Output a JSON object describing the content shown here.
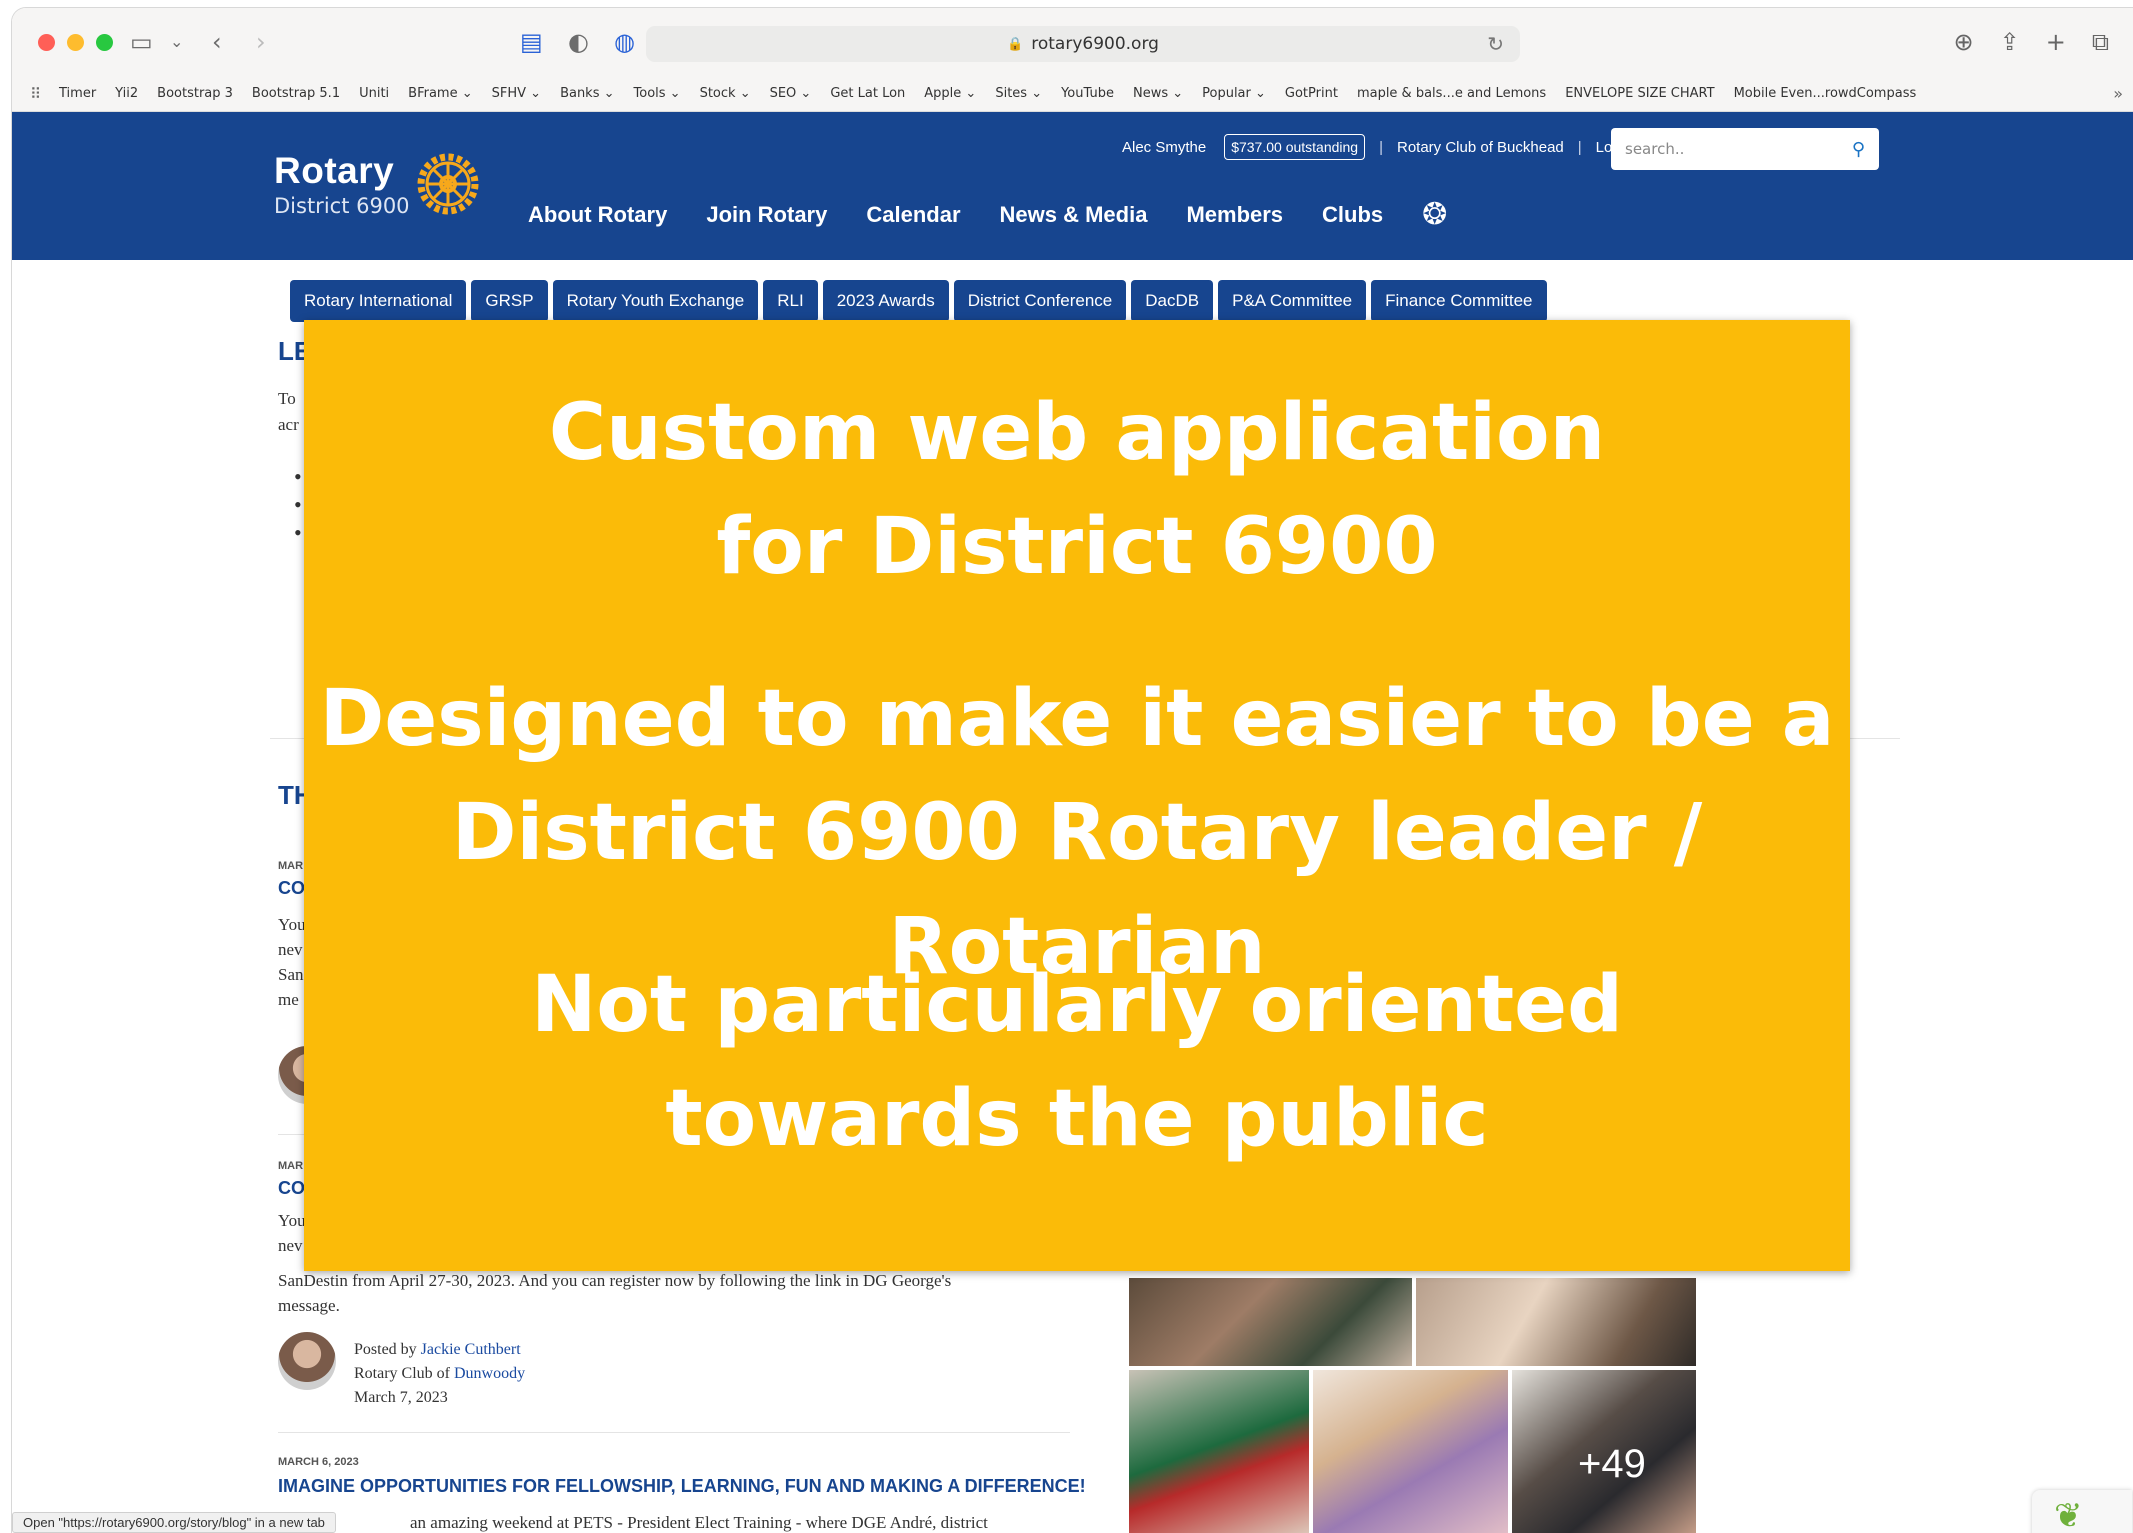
{
  "browser": {
    "url": "rotary6900.org",
    "bookmarks": [
      "Timer",
      "Yii2",
      "Bootstrap 3",
      "Bootstrap 5.1",
      "Uniti",
      "BFrame ⌄",
      "SFHV ⌄",
      "Banks ⌄",
      "Tools ⌄",
      "Stock ⌄",
      "SEO ⌄",
      "Get Lat Lon",
      "Apple ⌄",
      "Sites ⌄",
      "YouTube",
      "News ⌄",
      "Popular ⌄",
      "GotPrint",
      "maple & bals...e and Lemons",
      "ENVELOPE SIZE CHART",
      "Mobile Even...rowdCompass"
    ],
    "status_text": "Open \"https://rotary6900.org/story/blog\" in a new tab"
  },
  "header": {
    "logo_word": "Rotary",
    "logo_sub": "District 6900",
    "user_name": "Alec Smythe",
    "outstanding_badge": "$737.00 outstanding",
    "club_name": "Rotary Club of Buckhead",
    "logout_label": "Logout",
    "search_placeholder": "search..",
    "nav": [
      "About Rotary",
      "Join Rotary",
      "Calendar",
      "News & Media",
      "Members",
      "Clubs"
    ]
  },
  "subnav": [
    "Rotary International",
    "GRSP",
    "Rotary Youth Exchange",
    "RLI",
    "2023 Awards",
    "District Conference",
    "DacDB",
    "P&A Committee",
    "Finance Committee"
  ],
  "page": {
    "heading_partial_1": "LE",
    "para_partial_1": "To",
    "para_partial_2": "acr",
    "heading_partial_2": "TH",
    "story1_date_partial": "MAR",
    "story1_title_partial": "CO",
    "story1_lines_partial": [
      "You",
      "nev",
      "San",
      "me"
    ],
    "story2_date_partial": "MAR",
    "story2_title_partial": "CO",
    "story2_lines_partial": [
      "You",
      "nev"
    ],
    "story2_line3": "SanDestin from April 27-30, 2023. And you can register now by following the link in DG George's",
    "story2_line4": "message.",
    "story2_posted_by": "Posted by",
    "story2_author": "Jackie Cuthbert",
    "story2_club_prefix": "Rotary Club of",
    "story2_club": "Dunwoody",
    "story2_date": "March 7, 2023",
    "story3_date": "MARCH 6, 2023",
    "story3_title": "IMAGINE OPPORTUNITIES FOR FELLOWSHIP, LEARNING, FUN AND MAKING A DIFFERENCE!",
    "story3_line1": "an amazing weekend at PETS - President Elect Training - where DGE André, district",
    "photo_more": "+49"
  },
  "overlay": {
    "line1": "Custom web application",
    "line2": "for District 6900",
    "line3": "Designed to make it easier to be a",
    "line4": "District 6900 Rotary leader / Rotarian",
    "line5": "Not particularly oriented",
    "line6": "towards the public"
  },
  "colors": {
    "rotary_blue": "#17458f",
    "overlay_yellow": "#fbbb08",
    "rotary_gold": "#f7a81b"
  }
}
